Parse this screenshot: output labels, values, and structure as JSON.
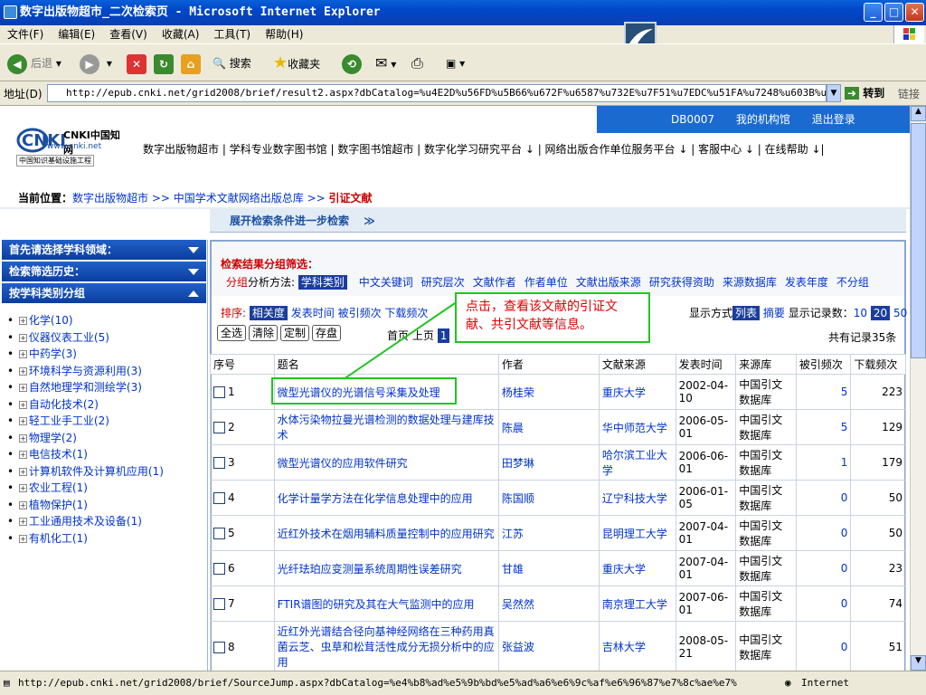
{
  "window": {
    "title": "数字出版物超市_二次检索页 - Microsoft Internet Explorer",
    "min": "_",
    "max": "□",
    "close": "✕"
  },
  "menu": [
    "文件(F)",
    "编辑(E)",
    "查看(V)",
    "收藏(A)",
    "工具(T)",
    "帮助(H)"
  ],
  "toolbar": {
    "back": "后退",
    "search": "搜索",
    "favorites": "收藏夹"
  },
  "address": {
    "label": "地址(D)",
    "url": "http://epub.cnki.net/grid2008/brief/result2.aspx?dbCatalog=%u4E2D%u56FD%u5B66%u672F%u6587%u732E%u7F51%u7EDC%u51FA%u7248%u603B%u5E93&showtit",
    "go": "转到",
    "links": "链接"
  },
  "site": {
    "db": "DB0007",
    "my_org": "我的机构馆",
    "logout": "退出登录",
    "logo_text": "CNKI中国知网",
    "logo_url": "www.cnki.net",
    "logo_sub": "中国知识基础设施工程",
    "nav": "数字出版物超市 | 学科专业数字图书馆 | 数字图书馆超市 | 数字化学习研究平台 ↓ | 网络出版合作单位服务平台 ↓ | 客服中心 ↓ | 在线帮助 ↓|",
    "crumb_label": "当前位置：",
    "crumb": "数字出版物超市 >> 中国学术文献网络出版总库 >> ",
    "crumb_current": "引证文献",
    "expand": "展开检索条件进一步检索　 ≫"
  },
  "sidebar": {
    "head1": "首先请选择学科领域：",
    "head2": "检索筛选历史：",
    "head3": "按学科类别分组",
    "items": [
      "化学(10)",
      "仪器仪表工业(5)",
      "中药学(3)",
      "环境科学与资源利用(3)",
      "自然地理学和测绘学(3)",
      "自动化技术(2)",
      "轻工业手工业(2)",
      "物理学(2)",
      "电信技术(1)",
      "计算机软件及计算机应用(1)",
      "农业工程(1)",
      "植物保护(1)",
      "工业通用技术及设备(1)",
      "有机化工(1)"
    ]
  },
  "group": {
    "title": "检索结果分组筛选：",
    "method_pre": "分组",
    "method": "分析方法:",
    "selected": "学科类别",
    "options": [
      "中文关键词",
      "研究层次",
      "文献作者",
      "作者单位",
      "文献出版来源",
      "研究获得资助",
      "来源数据库",
      "发表年度",
      "不分组"
    ]
  },
  "sort": {
    "label": "排序:",
    "selected": "相关度",
    "options": [
      "发表时间",
      "被引频次",
      "下载频次"
    ],
    "buttons": [
      "全选",
      "清除",
      "定制",
      "存盘"
    ],
    "first": "首页",
    "prev": "上页",
    "page": "1",
    "display_label": "显示方式",
    "list": "列表",
    "summary": "摘要",
    "count_label": "显示记录数：",
    "counts": [
      "10",
      "20",
      "50"
    ],
    "total": "共有记录35条"
  },
  "callout": "点击，查看该文献的引证文献、共引文献等信息。",
  "table": {
    "headers": [
      "序号",
      "题名",
      "作者",
      "文献来源",
      "发表时间",
      "来源库",
      "被引频次",
      "下载频次"
    ],
    "rows": [
      [
        "1",
        "微型光谱仪的光谱信号采集及处理",
        "杨桂荣",
        "重庆大学",
        "2002-04-10",
        "中国引文数据库",
        "5",
        "223"
      ],
      [
        "2",
        "水体污染物拉曼光谱检测的数据处理与建库技术",
        "陈晨",
        "华中师范大学",
        "2006-05-01",
        "中国引文数据库",
        "5",
        "129"
      ],
      [
        "3",
        "微型光谱仪的应用软件研究",
        "田梦琳",
        "哈尔滨工业大学",
        "2006-06-01",
        "中国引文数据库",
        "1",
        "179"
      ],
      [
        "4",
        "化学计量学方法在化学信息处理中的应用",
        "陈国顺",
        "辽宁科技大学",
        "2006-01-05",
        "中国引文数据库",
        "0",
        "50"
      ],
      [
        "5",
        "近红外技术在烟用辅料质量控制中的应用研究",
        "江苏",
        "昆明理工大学",
        "2007-04-01",
        "中国引文数据库",
        "0",
        "50"
      ],
      [
        "6",
        "光纤珐珀应变测量系统周期性误差研究",
        "甘雄",
        "重庆大学",
        "2007-04-01",
        "中国引文数据库",
        "0",
        "23"
      ],
      [
        "7",
        "FTIR谱图的研究及其在大气监测中的应用",
        "吴然然",
        "南京理工大学",
        "2007-06-01",
        "中国引文数据库",
        "0",
        "74"
      ],
      [
        "8",
        "近红外光谱结合径向基神经网络在三种药用真菌云芝、虫草和松茸活性成分无损分析中的应用",
        "张益波",
        "吉林大学",
        "2008-05-21",
        "中国引文数据库",
        "0",
        "51"
      ],
      [
        "",
        "",
        "",
        "",
        "",
        "中国引文",
        "",
        ""
      ]
    ]
  },
  "status": {
    "url": "http://epub.cnki.net/grid2008/brief/SourceJump.aspx?dbCatalog=%e4%b8%ad%e5%9b%bd%e5%ad%a6%e6%9c%af%e6%96%87%e7%8c%ae%e7%",
    "zone": "Internet"
  }
}
